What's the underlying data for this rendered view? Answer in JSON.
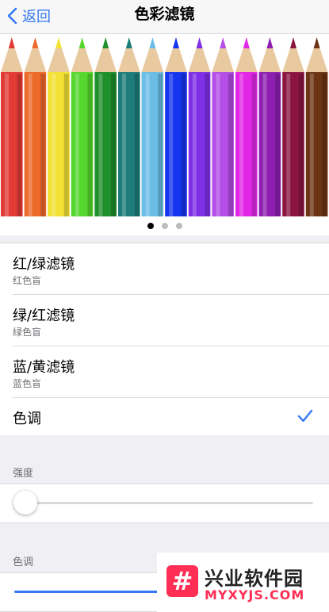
{
  "nav": {
    "back_label": "返回",
    "title": "色彩滤镜"
  },
  "hero": {
    "pencil_colors": [
      "#e23b35",
      "#ee6a2b",
      "#f2e234",
      "#56d72e",
      "#1f8f2c",
      "#1e7d7a",
      "#6bbde6",
      "#1535ee",
      "#7f2fe6",
      "#b44ee6",
      "#e226e6",
      "#8d1fb0",
      "#8a1640",
      "#6b3414"
    ],
    "page_count": 3,
    "active_page": 0
  },
  "filters": [
    {
      "title": "红/绿滤镜",
      "subtitle": "红色盲",
      "selected": false
    },
    {
      "title": "绿/红滤镜",
      "subtitle": "绿色盲",
      "selected": false
    },
    {
      "title": "蓝/黄滤镜",
      "subtitle": "蓝色盲",
      "selected": false
    },
    {
      "title": "色调",
      "subtitle": "",
      "selected": true
    }
  ],
  "intensity": {
    "label": "强度",
    "value": 0.0
  },
  "hue": {
    "label": "色调"
  },
  "watermark": {
    "name": "兴业软件园",
    "site": "MYXYJS.COM",
    "logo_glyph": "#"
  },
  "colors": {
    "accent": "#3478f6",
    "brand": "#ff2e55"
  }
}
